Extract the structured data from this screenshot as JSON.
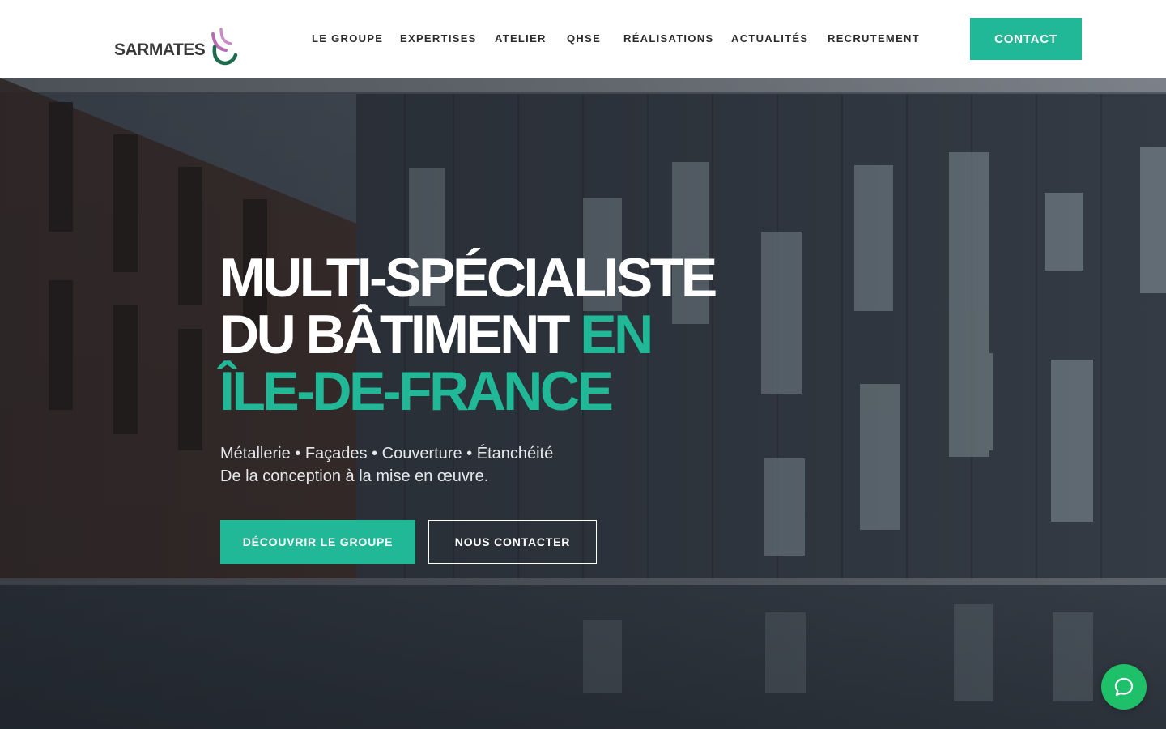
{
  "brand": {
    "name": "SARMATES",
    "accent_color": "#21b897",
    "mark_colors": [
      "#b56cb2",
      "#1f6b4f"
    ]
  },
  "nav": {
    "items": [
      {
        "label": "LE GROUPE"
      },
      {
        "label": "EXPERTISES"
      },
      {
        "label": "ATELIER"
      },
      {
        "label": "QHSE"
      },
      {
        "label": "RÉALISATIONS"
      },
      {
        "label": "ACTUALITÉS"
      },
      {
        "label": "RECRUTEMENT"
      }
    ],
    "contact_label": "CONTACT"
  },
  "hero": {
    "headline_line1": "MULTI-SPÉCIALISTE",
    "headline_line2_white": "DU BÂTIMENT ",
    "headline_line2_accent": "EN",
    "headline_line3_accent": "ÎLE-DE-FRANCE",
    "services": "Métallerie • Façades • Couverture • Étanchéité",
    "tagline": "De la conception à la mise en œuvre.",
    "primary_button": "DÉCOUVRIR LE GROUPE",
    "secondary_button": "NOUS CONTACTER"
  },
  "chat": {
    "icon": "chat-bubble-icon",
    "color": "#1fc06a"
  }
}
